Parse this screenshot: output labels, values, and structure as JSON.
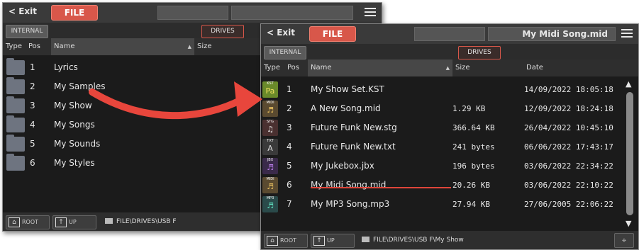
{
  "left_panel": {
    "exit_label": "< Exit",
    "file_tab": "FILE",
    "internal_tab": "INTERNAL",
    "drives_tab": "DRIVES",
    "columns": {
      "type": "Type",
      "pos": "Pos",
      "name": "Name",
      "size": "Size"
    },
    "rows": [
      {
        "pos": "1",
        "name": "Lyrics"
      },
      {
        "pos": "2",
        "name": "My Samples"
      },
      {
        "pos": "3",
        "name": "My Show"
      },
      {
        "pos": "4",
        "name": "My Songs"
      },
      {
        "pos": "5",
        "name": "My Sounds"
      },
      {
        "pos": "6",
        "name": "My Styles"
      }
    ],
    "root_label": "ROOT",
    "up_label": "UP",
    "path": "FILE\\DRIVES\\USB F"
  },
  "right_panel": {
    "exit_label": "< Exit",
    "file_tab": "FILE",
    "title": "My Midi Song.mid",
    "internal_tab": "INTERNAL",
    "drives_tab": "DRIVES",
    "columns": {
      "type": "Type",
      "pos": "Pos",
      "name": "Name",
      "size": "Size",
      "date": "Date"
    },
    "rows": [
      {
        "icon": "kst-icon",
        "icon_label": "KST",
        "icon_glyph": "Pa",
        "pos": "1",
        "name": "My Show Set.KST",
        "size": "",
        "date": "14/09/2022 18:05:18"
      },
      {
        "icon": "midi-icon",
        "icon_label": "MIDI",
        "icon_glyph": "♬",
        "pos": "2",
        "name": "A New Song.mid",
        "size": "1.29 KB",
        "date": "12/09/2022 18:24:18"
      },
      {
        "icon": "style-icon",
        "icon_label": "STG",
        "icon_glyph": "♫",
        "pos": "3",
        "name": "Future Funk New.stg",
        "size": "366.64 KB",
        "date": "26/04/2022 10:45:10"
      },
      {
        "icon": "txt-icon",
        "icon_label": "TXT",
        "icon_glyph": "A",
        "pos": "4",
        "name": "Future Funk New.txt",
        "size": "241 bytes",
        "date": "06/06/2022 17:43:17"
      },
      {
        "icon": "jbx-icon",
        "icon_label": "JBX",
        "icon_glyph": "♬",
        "pos": "5",
        "name": "My Jukebox.jbx",
        "size": "196 bytes",
        "date": "03/06/2022 22:34:22"
      },
      {
        "icon": "midi-icon",
        "icon_label": "MIDI",
        "icon_glyph": "♬",
        "pos": "6",
        "name": "My Midi Song.mid",
        "size": "20.26 KB",
        "date": "03/06/2022 22:10:22"
      },
      {
        "icon": "mp3-icon",
        "icon_label": "MP3",
        "icon_glyph": "♬",
        "pos": "7",
        "name": "My MP3 Song.mp3",
        "size": "27.94 KB",
        "date": "27/06/2005 22:06:22"
      }
    ],
    "root_label": "ROOT",
    "up_label": "UP",
    "path": "FILE\\DRIVES\\USB F\\My Show"
  },
  "colors": {
    "accent": "#d8574a",
    "arrow": "#e8463c",
    "panel_bg": "#1b1b1b"
  }
}
